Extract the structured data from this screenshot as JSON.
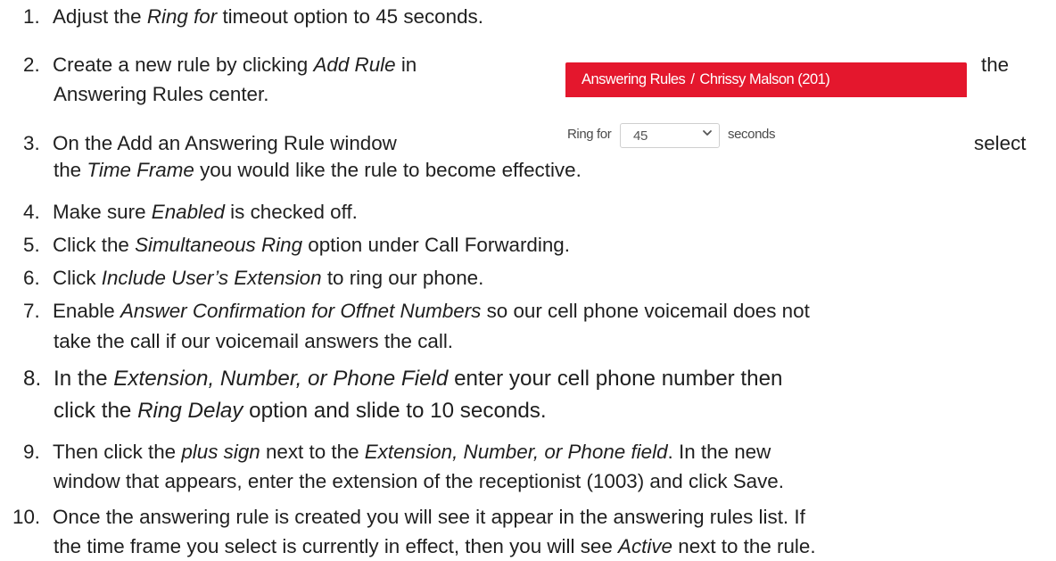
{
  "steps": [
    {
      "num": "1.",
      "parts": [
        "Adjust the ",
        "Ring for",
        " timeout option to 45 seconds."
      ]
    },
    {
      "num": "2.",
      "parts": [
        "Create a new rule by clicking ",
        "Add Rule",
        " in"
      ],
      "tail": "the",
      "line2": "Answering Rules center."
    },
    {
      "num": "3.",
      "parts": [
        "On the Add an Answering Rule window"
      ],
      "tail": "select",
      "line2_parts": [
        "the ",
        "Time Frame",
        " you would like the rule to become effective."
      ]
    },
    {
      "num": "4.",
      "parts": [
        "Make sure ",
        "Enabled",
        " is checked off."
      ]
    },
    {
      "num": "5.",
      "parts": [
        "Click the ",
        "Simultaneous Ring",
        " option under Call Forwarding."
      ]
    },
    {
      "num": "6.",
      "parts": [
        "Click ",
        "Include User’s Extension",
        " to ring our phone."
      ]
    },
    {
      "num": "7.",
      "parts": [
        "Enable ",
        "Answer Confirmation for Offnet Numbers",
        " so our cell phone voicemail does not"
      ],
      "line2": "take the call if our voicemail answers the call."
    },
    {
      "num": "8.",
      "parts": [
        "In the ",
        "Extension, Number, or Phone Field",
        " enter your cell phone number then"
      ],
      "line2_parts": [
        "click the ",
        "Ring Delay",
        " option and slide to 10 seconds."
      ]
    },
    {
      "num": "9.",
      "parts": [
        "Then click the ",
        "plus sign",
        " next to the ",
        "Extension, Number, or Phone field",
        ". In the new"
      ],
      "line2": "window that appears, enter the extension of the receptionist (1003) and click Save."
    },
    {
      "num": "10.",
      "line1": "Once the answering rule is created you will see it appear in the answering rules list. If",
      "line2_parts": [
        "the time frame you select is currently in effect, then you will see ",
        "Active",
        " next to the rule."
      ]
    }
  ],
  "inset": {
    "header_title": "Answering Rules",
    "header_sep": "/",
    "header_user": "Chrissy Malson (201)",
    "ring_for_label": "Ring for",
    "ring_for_value": "45",
    "ring_for_unit": "seconds",
    "chevron_icon": "chevron-down-icon",
    "header_color": "#e4172d"
  }
}
